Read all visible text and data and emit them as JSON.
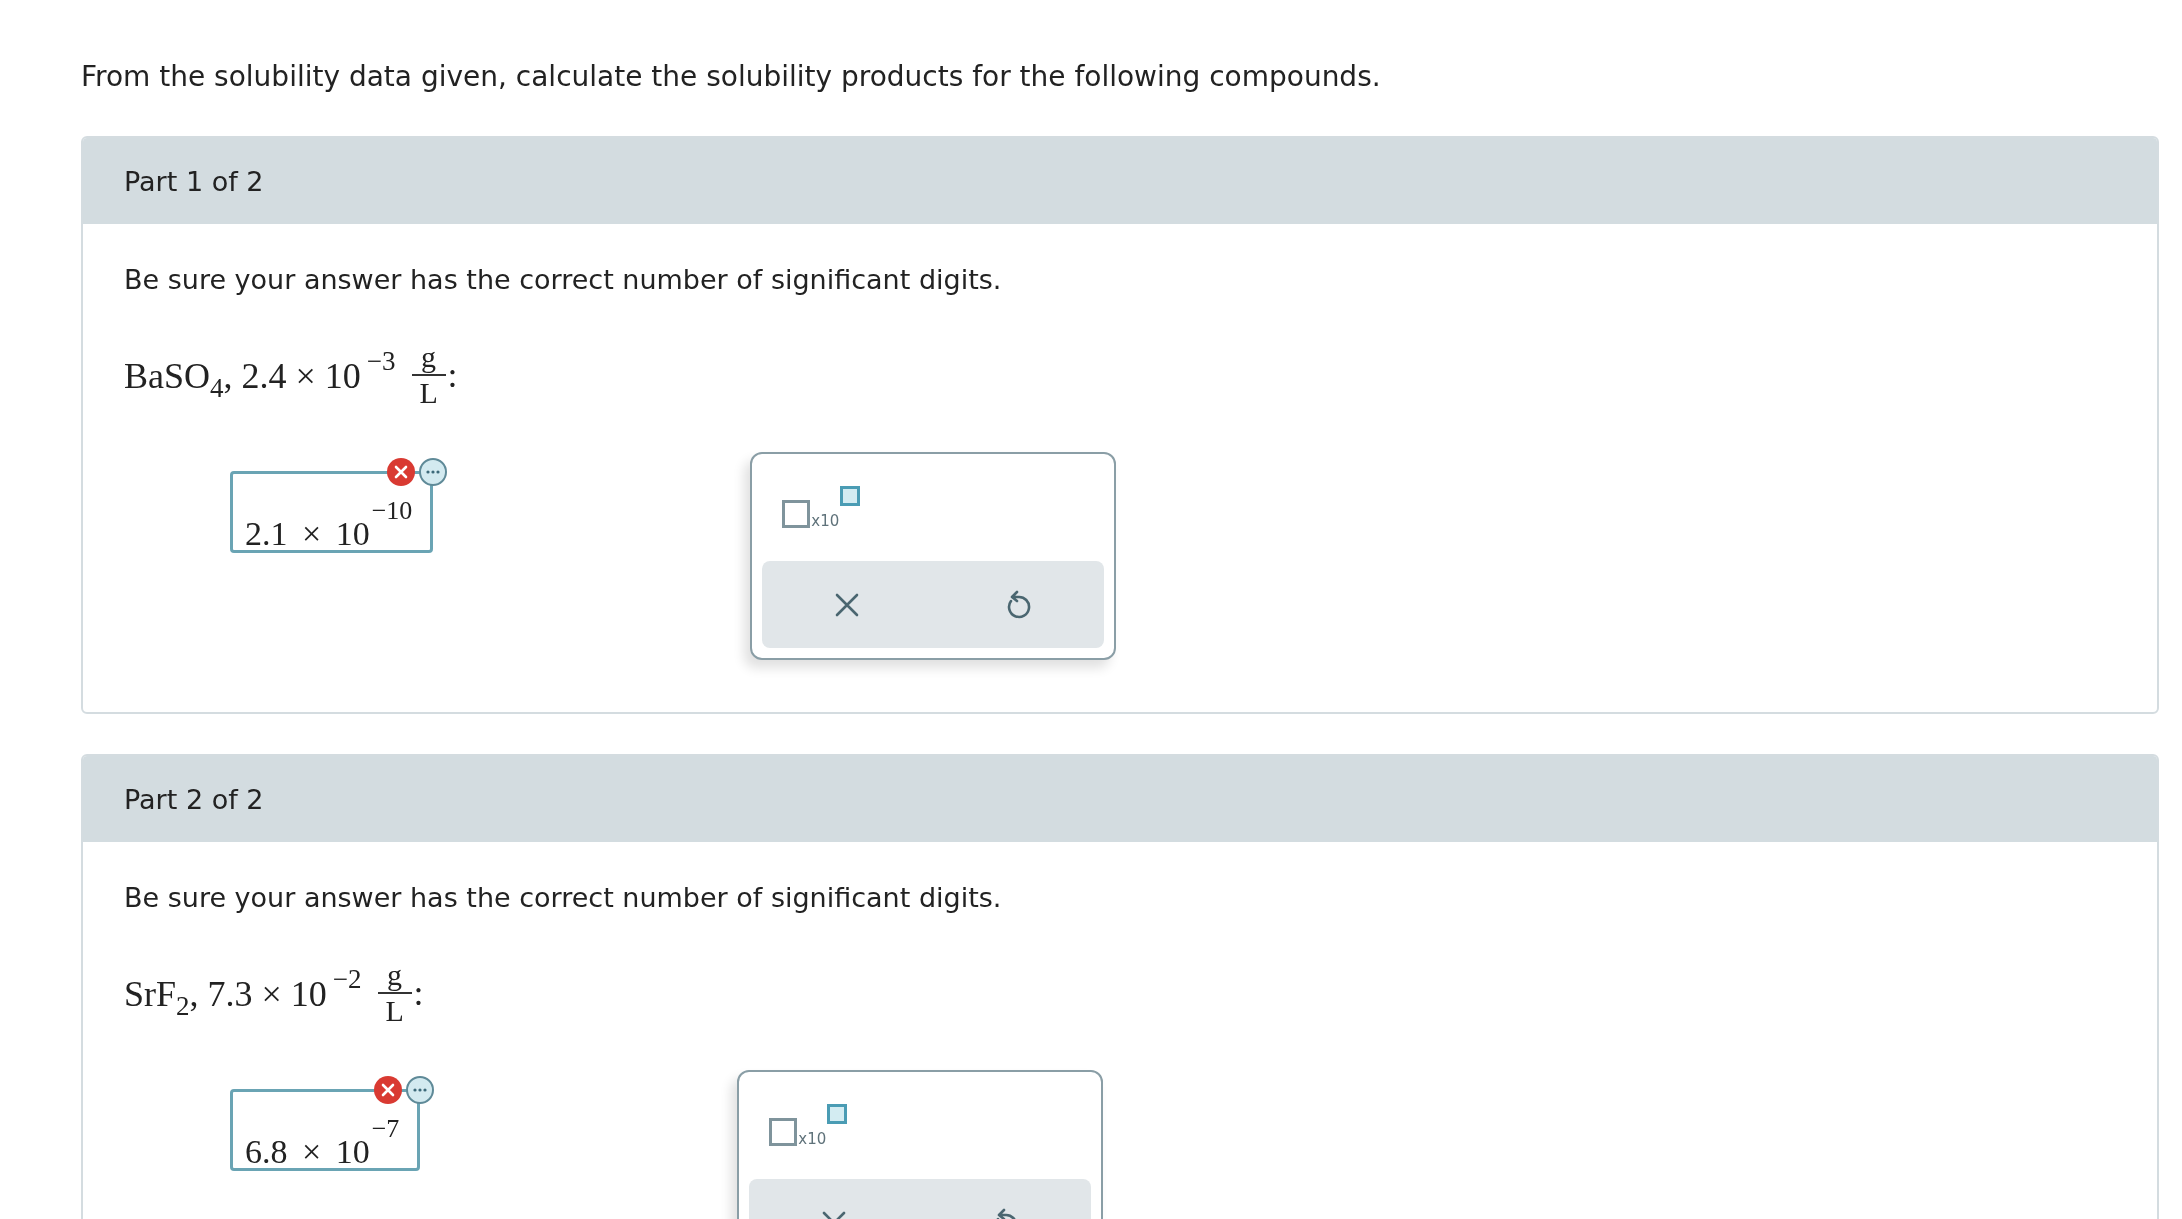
{
  "intro": "From the solubility data given, calculate the solubility products for the following compounds.",
  "parts": [
    {
      "header": "Part 1 of 2",
      "instruction": "Be sure your answer has the correct number of significant digits.",
      "formula": "BaSO$_{4}$, 2.4 × 10$^{−3}$",
      "unit_numerator": "g",
      "unit_denominator": "L",
      "formula_end": ":",
      "answer": "2.1 × 10$^{−10}$",
      "incorrect": true,
      "palette_label": "x10"
    },
    {
      "header": "Part 2 of 2",
      "instruction": "Be sure your answer has the correct number of significant digits.",
      "formula": "SrF$_{2}$, 7.3 × 10$^{−2}$",
      "unit_numerator": "g",
      "unit_denominator": "L",
      "formula_end": ":",
      "answer": "6.8 × 10$^{−7}$",
      "incorrect": true,
      "palette_label": "x10"
    }
  ]
}
